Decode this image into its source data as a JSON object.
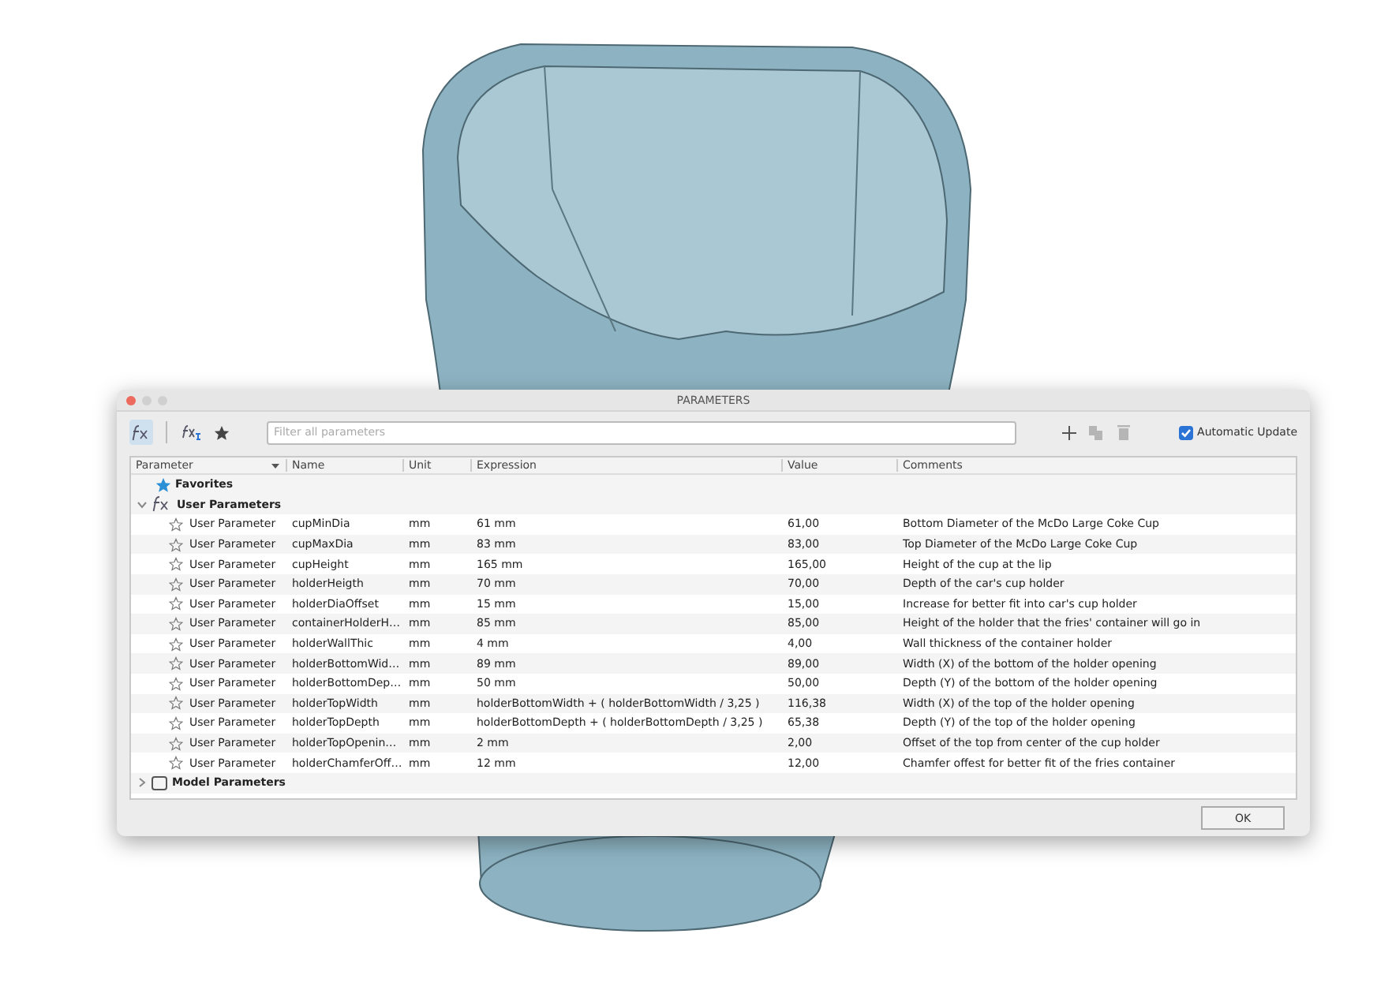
{
  "window": {
    "title": "PARAMETERS"
  },
  "toolbar": {
    "tools": [
      {
        "kind": "fx",
        "selected": true
      },
      {
        "kind": "fx-user",
        "selected": false
      },
      {
        "kind": "star",
        "selected": false
      }
    ],
    "search": {
      "placeholder": "Filter all parameters"
    },
    "actions": [
      {
        "kind": "add",
        "disabled": false
      },
      {
        "kind": "copy",
        "disabled": true
      },
      {
        "kind": "delete",
        "disabled": true
      }
    ],
    "auto_update": {
      "label": "Automatic Update",
      "checked": true
    }
  },
  "table": {
    "columns": [
      "Parameter",
      "Name",
      "Unit",
      "Expression",
      "Value",
      "Comments"
    ],
    "groups": [
      {
        "kind": "favorites",
        "label": "Favorites"
      },
      {
        "kind": "user",
        "label": "User Parameters",
        "expanded": true,
        "children": [
          {
            "type": "User Parameter",
            "name": "cupMinDia",
            "unit": "mm",
            "expression": "61 mm",
            "value": "61,00",
            "comment": "Bottom Diameter of the McDo Large Coke Cup",
            "favorite": false
          },
          {
            "type": "User Parameter",
            "name": "cupMaxDia",
            "unit": "mm",
            "expression": "83 mm",
            "value": "83,00",
            "comment": "Top Diameter of the McDo Large Coke Cup",
            "favorite": false
          },
          {
            "type": "User Parameter",
            "name": "cupHeight",
            "unit": "mm",
            "expression": "165 mm",
            "value": "165,00",
            "comment": "Height of the cup at the lip",
            "favorite": false
          },
          {
            "type": "User Parameter",
            "name": "holderHeigth",
            "unit": "mm",
            "expression": "70 mm",
            "value": "70,00",
            "comment": "Depth of the car's cup holder",
            "favorite": false
          },
          {
            "type": "User Parameter",
            "name": "holderDiaOffset",
            "unit": "mm",
            "expression": "15 mm",
            "value": "15,00",
            "comment": "Increase for better fit into car's cup holder",
            "favorite": false
          },
          {
            "type": "User Parameter",
            "name": "containerHolderH…",
            "unit": "mm",
            "expression": "85 mm",
            "value": "85,00",
            "comment": "Height of the holder that the fries' container will go in",
            "favorite": false
          },
          {
            "type": "User Parameter",
            "name": "holderWallThic",
            "unit": "mm",
            "expression": "4 mm",
            "value": "4,00",
            "comment": "Wall thickness of the container holder",
            "favorite": false
          },
          {
            "type": "User Parameter",
            "name": "holderBottomWid…",
            "unit": "mm",
            "expression": "89 mm",
            "value": "89,00",
            "comment": "Width (X) of the bottom of the holder opening",
            "favorite": false
          },
          {
            "type": "User Parameter",
            "name": "holderBottomDep…",
            "unit": "mm",
            "expression": "50 mm",
            "value": "50,00",
            "comment": "Depth (Y) of the bottom of the holder opening",
            "favorite": false
          },
          {
            "type": "User Parameter",
            "name": "holderTopWidth",
            "unit": "mm",
            "expression": "holderBottomWidth + ( holderBottomWidth / 3,25 )",
            "value": "116,38",
            "comment": "Width (X) of the top of the holder opening",
            "favorite": false
          },
          {
            "type": "User Parameter",
            "name": "holderTopDepth",
            "unit": "mm",
            "expression": "holderBottomDepth + ( holderBottomDepth / 3,25 )",
            "value": "65,38",
            "comment": "Depth (Y) of the top of the holder opening",
            "favorite": false
          },
          {
            "type": "User Parameter",
            "name": "holderTopOpenin…",
            "unit": "mm",
            "expression": "2 mm",
            "value": "2,00",
            "comment": "Offset of the top from center of the cup holder",
            "favorite": false
          },
          {
            "type": "User Parameter",
            "name": "holderChamferOff…",
            "unit": "mm",
            "expression": "12 mm",
            "value": "12,00",
            "comment": "Chamfer offest for better fit of the fries container",
            "favorite": false
          }
        ]
      },
      {
        "kind": "model",
        "label": "Model Parameters",
        "expanded": false
      }
    ]
  },
  "buttons": [
    "OK"
  ]
}
